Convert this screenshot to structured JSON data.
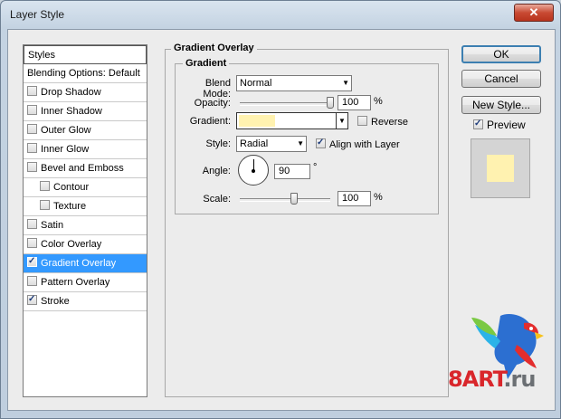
{
  "window": {
    "title": "Layer Style",
    "close_glyph": "✕"
  },
  "styles_list": {
    "header": "Styles",
    "blending": "Blending Options: Default",
    "items": [
      {
        "label": "Drop Shadow",
        "checked": false,
        "indent": false,
        "selected": false
      },
      {
        "label": "Inner Shadow",
        "checked": false,
        "indent": false,
        "selected": false
      },
      {
        "label": "Outer Glow",
        "checked": false,
        "indent": false,
        "selected": false
      },
      {
        "label": "Inner Glow",
        "checked": false,
        "indent": false,
        "selected": false
      },
      {
        "label": "Bevel and Emboss",
        "checked": false,
        "indent": false,
        "selected": false
      },
      {
        "label": "Contour",
        "checked": false,
        "indent": true,
        "selected": false
      },
      {
        "label": "Texture",
        "checked": false,
        "indent": true,
        "selected": false
      },
      {
        "label": "Satin",
        "checked": false,
        "indent": false,
        "selected": false
      },
      {
        "label": "Color Overlay",
        "checked": false,
        "indent": false,
        "selected": false
      },
      {
        "label": "Gradient Overlay",
        "checked": true,
        "indent": false,
        "selected": true
      },
      {
        "label": "Pattern Overlay",
        "checked": false,
        "indent": false,
        "selected": false
      },
      {
        "label": "Stroke",
        "checked": true,
        "indent": false,
        "selected": false
      }
    ]
  },
  "panel": {
    "title": "Gradient Overlay",
    "section": "Gradient",
    "blend_mode_label": "Blend Mode:",
    "blend_mode_value": "Normal",
    "opacity_label": "Opacity:",
    "opacity_value": "100",
    "opacity_level": 1.0,
    "percent": "%",
    "gradient_label": "Gradient:",
    "gradient_color": "#fff2b0",
    "reverse_label": "Reverse",
    "reverse_checked": false,
    "style_label": "Style:",
    "style_value": "Radial",
    "align_label": "Align with Layer",
    "align_checked": true,
    "angle_label": "Angle:",
    "angle_value": "90",
    "degree": "°",
    "scale_label": "Scale:",
    "scale_value": "100",
    "scale_level": 0.6
  },
  "buttons": {
    "ok": "OK",
    "cancel": "Cancel",
    "new_style": "New Style...",
    "preview_label": "Preview",
    "preview_checked": true
  },
  "preview_color": "#fff2b0",
  "logo": {
    "text_a": "8",
    "text_b": "ART",
    "text_c": ".ru"
  },
  "colors": {
    "selection": "#3399ff"
  }
}
